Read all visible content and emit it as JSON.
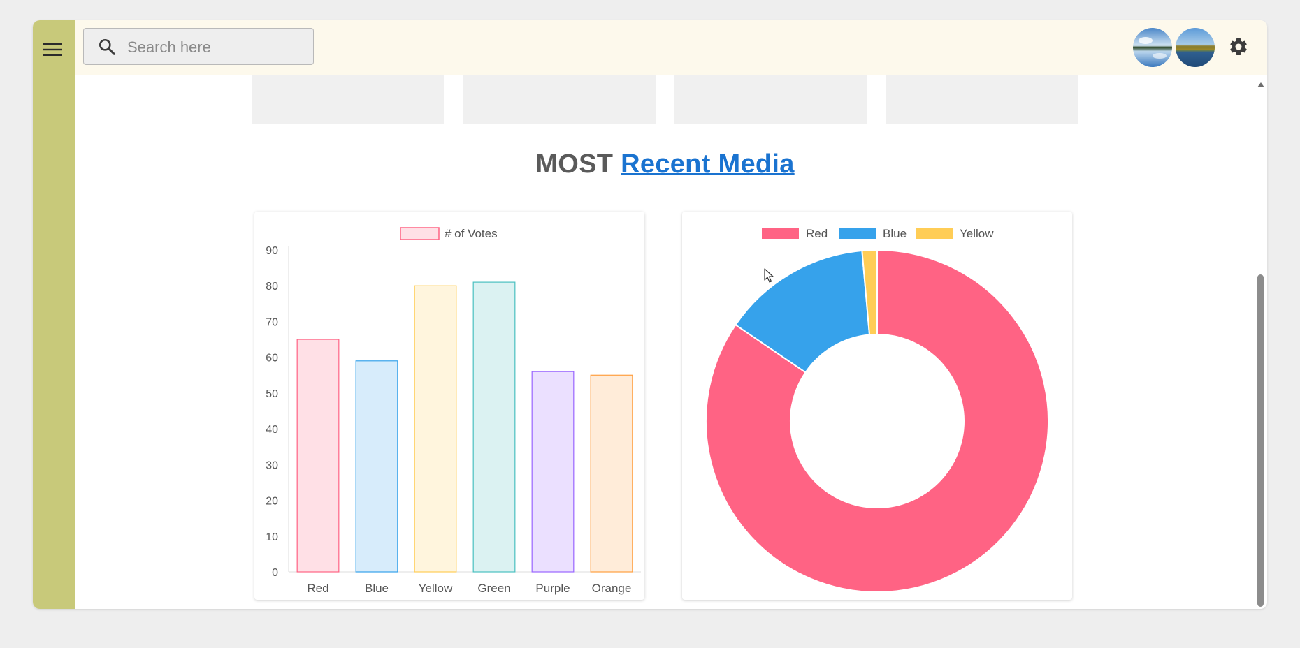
{
  "search": {
    "placeholder": "Search here",
    "value": ""
  },
  "heading": {
    "prefix": "MOST",
    "link": "Recent Media"
  },
  "chart_data": [
    {
      "type": "bar",
      "categories": [
        "Red",
        "Blue",
        "Yellow",
        "Green",
        "Purple",
        "Orange"
      ],
      "series": [
        {
          "name": "# of Votes",
          "values": [
            65,
            59,
            80,
            81,
            56,
            55
          ]
        }
      ],
      "ylim": [
        0,
        90
      ],
      "yticks": [
        0,
        10,
        20,
        30,
        40,
        50,
        60,
        70,
        80,
        90
      ],
      "legend": "top",
      "grid": false,
      "fill_colors": [
        "#ffe0e6",
        "#d7ecfb",
        "#fff5dd",
        "#dbf2f2",
        "#ebe0ff",
        "#ffecd9"
      ],
      "border_colors": [
        "#ff6384",
        "#36a2eb",
        "#ffcd56",
        "#4bc0c0",
        "#9966ff",
        "#ff9f40"
      ]
    },
    {
      "type": "pie",
      "variant": "doughnut",
      "categories": [
        "Red",
        "Blue",
        "Yellow"
      ],
      "values": [
        300,
        50,
        5
      ],
      "colors": [
        "#ff6384",
        "#36a2eb",
        "#ffcd56"
      ],
      "legend": "top"
    }
  ],
  "colors": {
    "sidebar": "#c8c97a",
    "topbar": "#fdf9ec",
    "link": "#1a73d0"
  },
  "icons": {
    "menu": "hamburger-menu-icon",
    "search": "magnifier-icon",
    "settings": "gear-icon"
  }
}
